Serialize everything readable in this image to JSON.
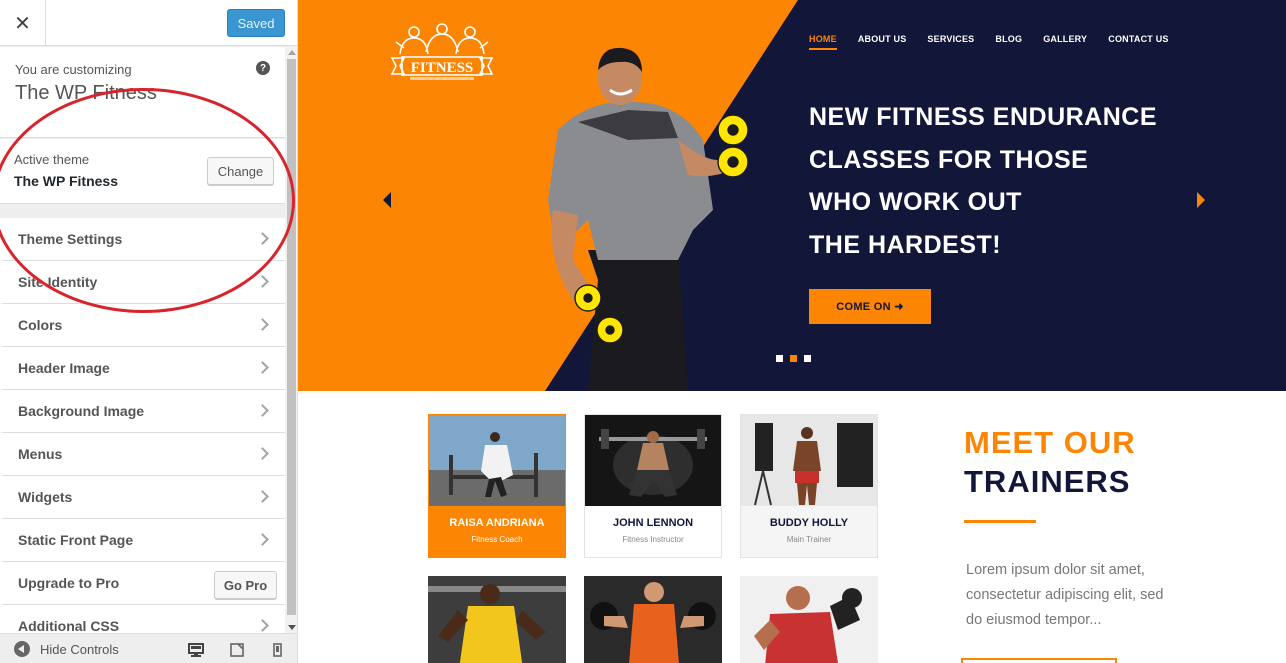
{
  "topbar": {
    "close_glyph": "✕",
    "saved_label": "Saved"
  },
  "info": {
    "customizing_label": "You are customizing",
    "site_title": "The WP Fitness",
    "help_glyph": "?"
  },
  "theme": {
    "label": "Active theme",
    "name": "The WP Fitness",
    "change_label": "Change"
  },
  "sections": [
    {
      "label": "Theme Settings"
    },
    {
      "label": "Site Identity"
    },
    {
      "label": "Colors"
    },
    {
      "label": "Header Image"
    },
    {
      "label": "Background Image"
    },
    {
      "label": "Menus"
    },
    {
      "label": "Widgets"
    },
    {
      "label": "Static Front Page"
    },
    {
      "label": "Upgrade to Pro",
      "button": "Go Pro"
    },
    {
      "label": "Additional CSS"
    }
  ],
  "footer": {
    "hide_label": "Hide Controls"
  },
  "preview": {
    "logo_text": "FITNESS",
    "nav": [
      "HOME",
      "ABOUT US",
      "SERVICES",
      "BLOG",
      "GALLERY",
      "CONTACT US"
    ],
    "hero_lines": [
      "NEW FITNESS ENDURANCE",
      "CLASSES FOR THOSE",
      "WHO WORK OUT",
      "THE HARDEST!"
    ],
    "cta_label": "COME ON ➜",
    "slides": 3,
    "active_slide": 2,
    "trainers": [
      {
        "name": "RAISA ANDRIANA",
        "role": "Fitness Coach"
      },
      {
        "name": "JOHN LENNON",
        "role": "Fitness Instructor"
      },
      {
        "name": "BUDDY HOLLY",
        "role": "Main Trainer"
      }
    ],
    "meet_line1": "MEET OUR",
    "meet_line2": "TRAINERS",
    "lorem": "Lorem ipsum dolor sit amet, consectetur adipiscing elit, sed do eiusmod tempor..."
  },
  "colors": {
    "accent": "#fd8504",
    "navy": "#121639",
    "wp_blue": "#3a96d1",
    "annotation_red": "#d9232d"
  }
}
